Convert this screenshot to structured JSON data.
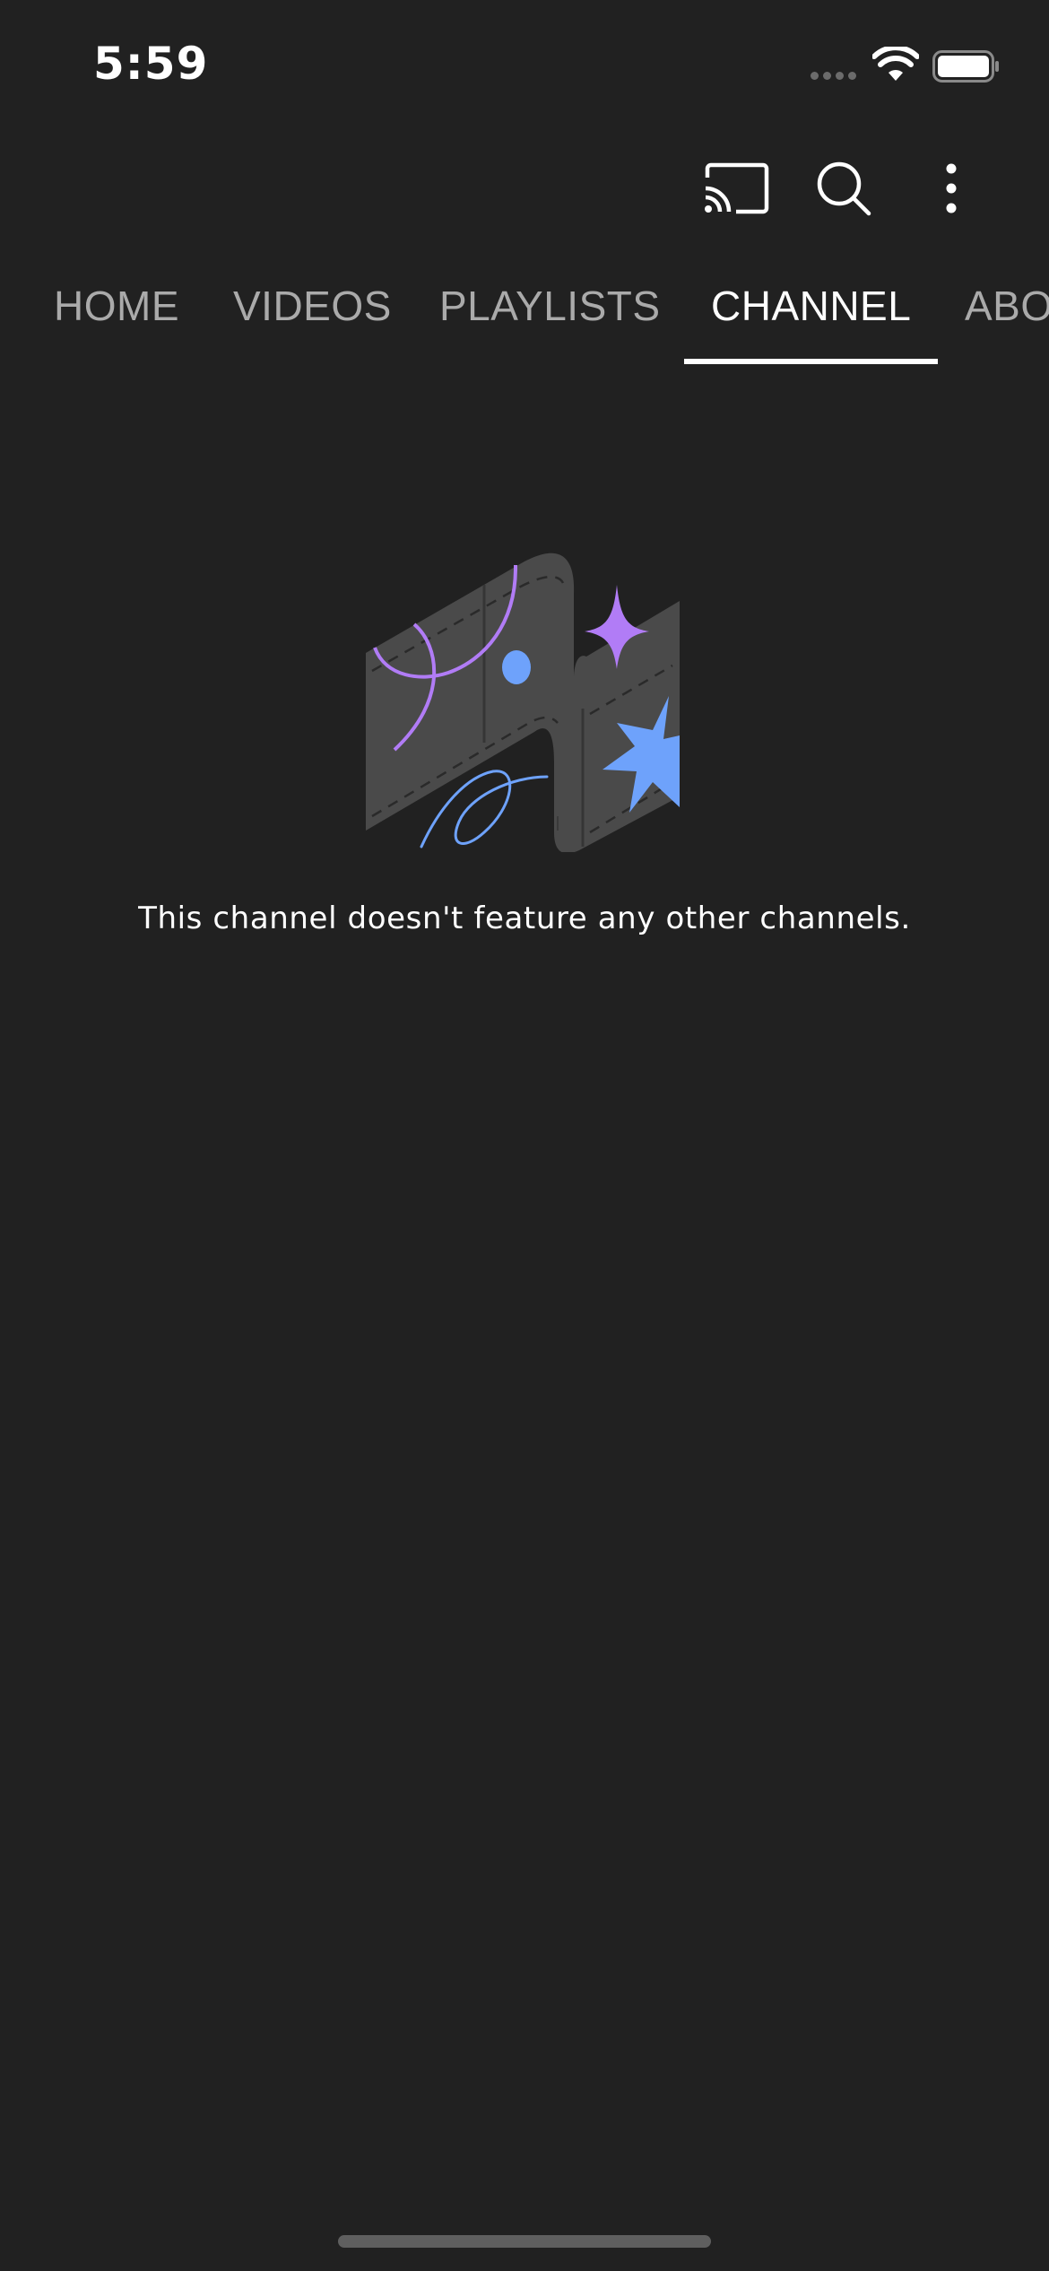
{
  "status_bar": {
    "time": "5:59"
  },
  "toolbar": {
    "cast_icon": "cast-icon",
    "search_icon": "search-icon",
    "more_icon": "more-vertical-icon"
  },
  "tabs": [
    {
      "label": "HOME",
      "active": false
    },
    {
      "label": "VIDEOS",
      "active": false
    },
    {
      "label": "PLAYLISTS",
      "active": false
    },
    {
      "label": "CHANNEL",
      "active": true
    },
    {
      "label": "ABO",
      "active": false
    }
  ],
  "empty_state": {
    "message": "This channel doesn't feature any other channels."
  },
  "colors": {
    "background": "#212121",
    "tab_inactive": "#aaaaaa",
    "tab_active": "#ffffff",
    "accent_purple": "#b17cf6",
    "accent_blue": "#6ea2fb"
  }
}
